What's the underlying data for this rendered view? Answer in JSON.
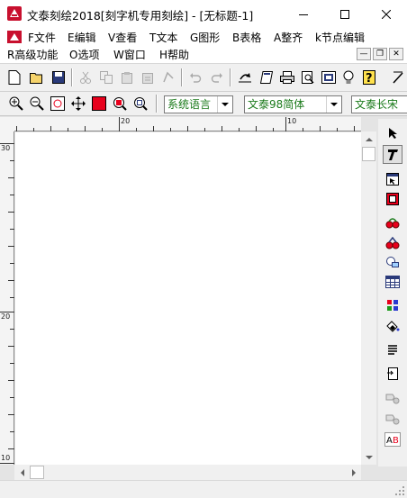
{
  "window": {
    "title": "文泰刻绘2018[刻字机专用刻绘] - [无标题-1]",
    "minimize_glyph": "—",
    "maximize_glyph": "☐",
    "close_glyph": "✕"
  },
  "menu": {
    "row1": [
      "F文件",
      "E编辑",
      "V查看",
      "T文本",
      "G图形",
      "B表格",
      "A整齐",
      "k节点编辑"
    ],
    "row2": [
      "R高级功能",
      "O选项",
      "W窗口",
      "H帮助"
    ],
    "mdi_min": "—",
    "mdi_restore": "❐",
    "mdi_close": "✕"
  },
  "toolbar2": {
    "language_combo": "系统语言",
    "font_combo": "文泰98简体",
    "font_combo2": "文泰长宋"
  },
  "rulers": {
    "h_labels": [
      "20",
      "10"
    ],
    "v_labels": [
      "30",
      "20",
      "10"
    ]
  },
  "colors": {
    "accent_red": "#e8001c",
    "text_green": "#1a7a1a"
  }
}
